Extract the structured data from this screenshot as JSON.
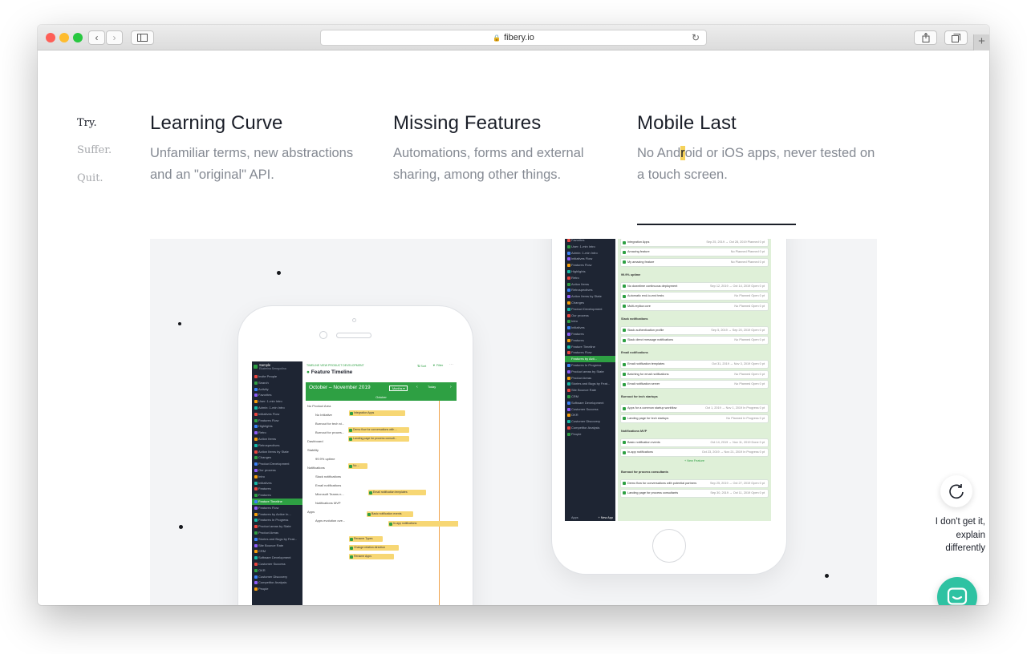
{
  "browser": {
    "url": "fibery.io"
  },
  "nav": {
    "items": [
      {
        "label": "Try."
      },
      {
        "label": "Suffer."
      },
      {
        "label": "Quit."
      }
    ]
  },
  "columns": [
    {
      "title": "Learning Curve",
      "desc": "Unfamiliar terms, new abstractions and an \"original\" API."
    },
    {
      "title": "Missing Features",
      "desc": "Automations, forms and external sharing, among other things."
    },
    {
      "title": "Mobile Last",
      "desc_before": "No And",
      "desc_highlight": "r",
      "desc_after": "oid or iOS apps, never tested on a touch screen."
    }
  ],
  "phone_left": {
    "workspace": "Sample",
    "workspace_sub": "Ekaterina Seregodina",
    "breadcrumb": "TIMELINE VIEW  PRODUCT DEVELOPMENT",
    "sort_label": "Sort",
    "filter_label": "Filter",
    "view_title": "Feature Timeline",
    "range": "October – November 2019",
    "month_select": "Months",
    "today": "Today",
    "month_label": "October",
    "sidebar": [
      "Invite People",
      "Search",
      "Activity",
      "Favorites",
      "User: 1-min Intro",
      "Admin: 1-min Intro",
      "Initiatives Flow",
      "Features Flow",
      "Highlights",
      "Retro",
      "Action Items",
      "Retrospectives",
      "Action Items by State",
      "Changes",
      "Product Development",
      "Our process",
      "Intro",
      "Initiatives",
      "Features",
      "Features",
      "Feature Timeline",
      "Features Flow",
      "Features by Active In...",
      "Features In Progress",
      "Product areas by State",
      "Product Areas",
      "Stories and Bugs by Feat...",
      "Site Bounce Rate",
      "CRM",
      "Software Development",
      "Customer Success",
      "OKR",
      "Customer Discovery",
      "Competitor Analysis",
      "People"
    ],
    "rows": [
      "No Product Area",
      "No Initiative",
      "Burnout for tech st...",
      "Burnout for proces...",
      "Dashboard",
      "Stability",
      "99.9% uptime",
      "Notifications",
      "Slack notifications",
      "Email notifications",
      "Microsoft Teams n...",
      "Notifications MVP",
      "Apps",
      "Apps evolution ove..."
    ],
    "bars": [
      "Integration Apps",
      "Demo flow for conversations with ...",
      "Landing page for process consult...",
      "No ...",
      "Email notification templates",
      "Basic notification events",
      "In-app notifications",
      "Rename Types",
      "Change relation direction",
      "Rename Apps"
    ]
  },
  "phone_right": {
    "sidebar": [
      "Favorites",
      "User: 1-min Intro",
      "Admin: 1-min Intro",
      "Initiatives Flow",
      "Features Flow",
      "Highlights",
      "Retro",
      "Action Items",
      "Retrospectives",
      "Action Items by State",
      "Changes",
      "Product Development",
      "Our process",
      "Intro",
      "Initiatives",
      "Features",
      "Features",
      "Feature Timeline",
      "Features Flow",
      "Features by Acti...",
      "Features In Progress",
      "Product areas by State",
      "Product Areas",
      "Stories and Bugs by Feat...",
      "Site Bounce Rate",
      "CRM",
      "Software Development",
      "Customer Success",
      "OKR",
      "Customer Discovery",
      "Competitor Analysis",
      "People"
    ],
    "apps_label": "Apps",
    "new_app_label": "+ New App",
    "groups": [
      {
        "name": "",
        "items": [
          {
            "title": "Integration Apps",
            "meta": "Sep 25, 2019 → Oct 28, 2019  Planned  0 pt"
          },
          {
            "title": "Amazing feature",
            "meta": "No Planned  Planned  0 pt"
          },
          {
            "title": "My amazing feature",
            "meta": "No Planned  Planned  0 pt"
          }
        ]
      },
      {
        "name": "99.9% uptime",
        "items": [
          {
            "title": "No downtime continuous deployment",
            "meta": "Sep 12, 2019 → Oct 14, 2019  Open  0 pt"
          },
          {
            "title": "Automatic end-to-end tests",
            "meta": "No Planned  Open  0 pt"
          },
          {
            "title": "Multi-replica core",
            "meta": "No Planned  Open  0 pt"
          }
        ]
      },
      {
        "name": "Slack notifications",
        "items": [
          {
            "title": "Slack authentication profile",
            "meta": "Sep 5, 2019 → Sep 20, 2019  Open  0 pt"
          },
          {
            "title": "Slack direct message notifications",
            "meta": "No Planned  Open  0 pt"
          }
        ]
      },
      {
        "name": "Email notifications",
        "items": [
          {
            "title": "Email notification templates",
            "meta": "Oct 31, 2019 → Nov 3, 2019  Open  0 pt"
          },
          {
            "title": "Batching for email notifications",
            "meta": "No Planned  Open  0 pt"
          },
          {
            "title": "Email notification server",
            "meta": "No Planned  Open  0 pt"
          }
        ]
      },
      {
        "name": "Burnout for tech startups",
        "items": [
          {
            "title": "Apps for a common startup workflow",
            "meta": "Oct 1, 2019 → Nov 1, 2019  In Progress  0 pt"
          },
          {
            "title": "Landing page for tech startups",
            "meta": "No Planned  In Progress  0 pt"
          }
        ]
      },
      {
        "name": "Notifications MVP",
        "items": [
          {
            "title": "Basic notification events",
            "meta": "Oct 14, 2019 → Nov 11, 2019  Done  0 pt"
          },
          {
            "title": "In-app notifications",
            "meta": "Oct 23, 2019 → Nov 21, 2019  In Progress  0 pt"
          }
        ]
      },
      {
        "name": "Burnout for process consultants",
        "items": [
          {
            "title": "Demo flow for conversations with potential partners",
            "meta": "Sep 25, 2019 → Oct 27, 2019  Open  0 pt"
          },
          {
            "title": "Landing page for process consultants",
            "meta": "Sep 30, 2019 → Oct 11, 2019  Open  0 pt"
          }
        ]
      }
    ],
    "new_feature": "+ New Feature"
  },
  "explain": {
    "line1": "I don't get it,",
    "line2": "explain",
    "line3": "differently"
  },
  "colors": {
    "accent_green": "#2ea043",
    "highlight": "#f5d25a",
    "chat": "#2ec2a2",
    "sidebar_dark": "#1e2533"
  }
}
